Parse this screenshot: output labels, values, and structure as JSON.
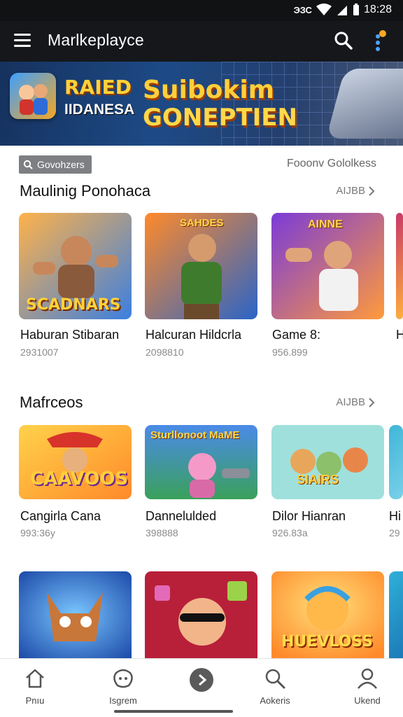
{
  "status_bar": {
    "network": "ЭЗС",
    "time": "18:28"
  },
  "app_bar": {
    "title": "Marlkeplayce",
    "menu_icon": "hamburger-menu-icon",
    "search_icon": "search-icon",
    "more_icon": "more-vertical-icon",
    "notification_color": "#f5a623"
  },
  "banner": {
    "brand_line_1": "RAIED",
    "brand_line_2": "IIDANESA",
    "headline_line_1": "Suibokim",
    "headline_line_2": "GONEPTIEN"
  },
  "filter": {
    "chip_label": "Govohzers",
    "right_label": "Fooonv Gololkess"
  },
  "sections": [
    {
      "title": "Maulinig Ponohaca",
      "see_all": "AIJBB",
      "items": [
        {
          "name": "Haburan Stibaran",
          "meta": "2931007",
          "art_text": "SCADNARS"
        },
        {
          "name": "Halcuran Hildcrla",
          "meta": "2098810",
          "art_text": "SAHDES"
        },
        {
          "name": "Game 8:",
          "meta": "956.899",
          "art_text": "AINNE"
        },
        {
          "name": "H",
          "meta": ""
        }
      ]
    },
    {
      "title": "Mafrceos",
      "see_all": "AIJBB",
      "items": [
        {
          "name": "Cangirla Cana",
          "meta": "993:36y",
          "art_text": "CAAVOOS"
        },
        {
          "name": "Dannelulded",
          "meta": "398888",
          "art_text": "Sturllonoot MaME"
        },
        {
          "name": "Dilor Hianran",
          "meta": "926.83a",
          "art_text": "SIAIRS"
        },
        {
          "name": "Hi",
          "meta": "29"
        }
      ]
    },
    {
      "title": "",
      "items": [
        {
          "name": "",
          "art_text": ""
        },
        {
          "name": "",
          "art_text": ""
        },
        {
          "name": "",
          "art_text": "HUEVLOSS"
        },
        {
          "name": "",
          "art_text": ""
        }
      ]
    }
  ],
  "bottom_nav": [
    {
      "label": "Pnıu",
      "icon": "home-icon"
    },
    {
      "label": "Isgrem",
      "icon": "games-icon"
    },
    {
      "label": "",
      "icon": "play-circle-icon"
    },
    {
      "label": "Aokeris",
      "icon": "search-icon"
    },
    {
      "label": "Ukend",
      "icon": "profile-icon"
    }
  ]
}
